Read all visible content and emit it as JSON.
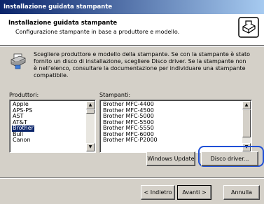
{
  "window": {
    "title": "Installazione guidata stampante"
  },
  "header": {
    "title": "Installazione guidata stampante",
    "subtitle": "Configurazione stampante in base a produttore e modello."
  },
  "info": {
    "text": "Scegliere produttore e modello della stampante. Se con la stampante è stato fornito un disco di installazione, scegliere Disco driver. Se la stampante non è nell'elenco, consultare la documentazione per individuare una stampante compatibile."
  },
  "manufacturers": {
    "label": "Produttori:",
    "items": [
      "Apple",
      "APS-PS",
      "AST",
      "AT&T",
      "Brother",
      "Bull",
      "Canon"
    ],
    "selected": "Brother"
  },
  "printers": {
    "label": "Stampanti:",
    "items": [
      "Brother MFC-4400",
      "Brother MFC-4500",
      "Brother MFC-5000",
      "Brother MFC-5500",
      "Brother MFC-5550",
      "Brother MFC-6000",
      "Brother MFC-P2000"
    ]
  },
  "buttons": {
    "windows_update": "Windows Update",
    "disk_driver": "Disco driver...",
    "back": "< Indietro",
    "next": "Avanti >",
    "cancel": "Annulla"
  },
  "icons": {
    "scroll_up": "▲",
    "scroll_down": "▼"
  }
}
